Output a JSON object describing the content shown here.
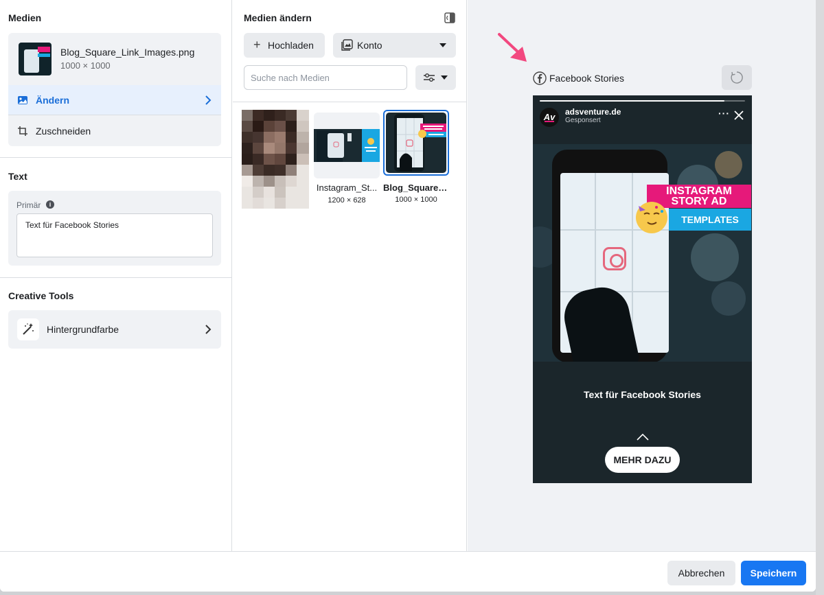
{
  "left_panel": {
    "medien_title": "Medien",
    "file": {
      "name": "Blog_Square_Link_Images.png",
      "dimensions": "1000 × 1000"
    },
    "actions": {
      "aendern": "Ändern",
      "zuschneiden": "Zuschneiden"
    },
    "text_section": {
      "title": "Text",
      "primary_label": "Primär",
      "primary_value": "Text für Facebook Stories"
    },
    "creative_tools": {
      "title": "Creative Tools",
      "background_color": "Hintergrundfarbe"
    }
  },
  "middle_panel": {
    "title": "Medien ändern",
    "upload_label": "Hochladen",
    "konto_label": "Konto",
    "search_placeholder": "Suche nach Medien",
    "tiles": [
      {
        "name": "",
        "dimensions": ""
      },
      {
        "name": "Instagram_St...",
        "dimensions": "1200 × 628"
      },
      {
        "name": "Blog_Square_...",
        "dimensions": "1000 × 1000"
      }
    ]
  },
  "right_panel": {
    "placement_label": "Facebook Stories",
    "story": {
      "account_name": "adsventure.de",
      "sponsored": "Gesponsert",
      "avatar_text": "Av",
      "more_dots": "···",
      "banner_line1": "INSTAGRAM",
      "banner_line2": "STORY AD",
      "banner_templates": "TEMPLATES",
      "primary_text": "Text für Facebook Stories",
      "cta_label": "MEHR DAZU",
      "progress": 0.9
    }
  },
  "footer": {
    "cancel_label": "Abbrechen",
    "save_label": "Speichern"
  },
  "colors": {
    "accent_blue": "#1877f2",
    "selected_row": "#e7f0fd",
    "panel_gray": "#f0f2f5",
    "story_bg": "#1b262b",
    "arrow_pink": "#f2487f",
    "brand_pink": "#e6197a",
    "brand_cyan": "#1aa7e2"
  },
  "icons": {
    "aendern": "image-icon",
    "zuschneiden": "crop-icon",
    "background": "magic-wand-icon",
    "upload": "plus-icon",
    "konto": "gallery-icon",
    "filter": "sliders-icon",
    "placement": "facebook-icon",
    "refresh": "refresh-icon"
  }
}
